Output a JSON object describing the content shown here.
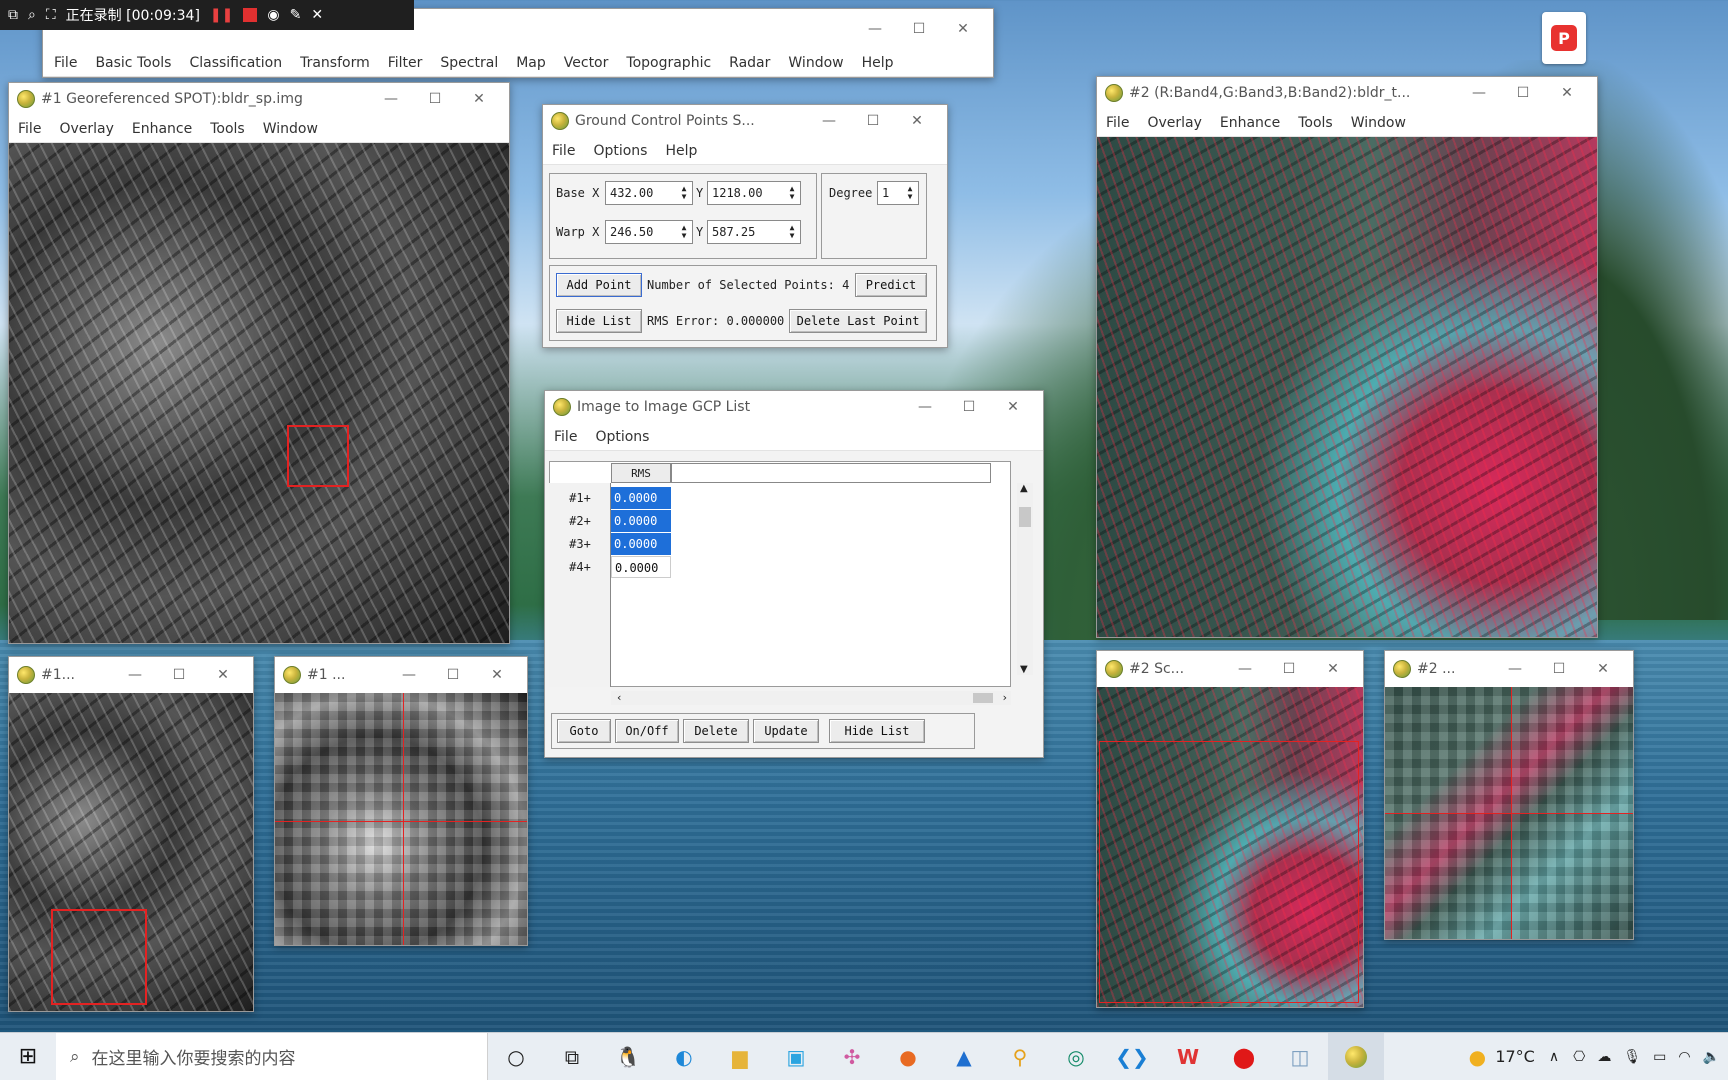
{
  "recorder": {
    "status": "正在录制 [00:09:34]"
  },
  "envi_main": {
    "menu": [
      "File",
      "Basic Tools",
      "Classification",
      "Transform",
      "Filter",
      "Spectral",
      "Map",
      "Vector",
      "Topographic",
      "Radar",
      "Window",
      "Help"
    ]
  },
  "display1": {
    "title": "#1 Georeferenced SPOT):bldr_sp.img",
    "menu": [
      "File",
      "Overlay",
      "Enhance",
      "Tools",
      "Window"
    ]
  },
  "display1_scroll": {
    "title": "#1..."
  },
  "display1_zoom": {
    "title": "#1 ..."
  },
  "display2": {
    "title": "#2 (R:Band4,G:Band3,B:Band2):bldr_t...",
    "menu": [
      "File",
      "Overlay",
      "Enhance",
      "Tools",
      "Window"
    ]
  },
  "display2_scroll": {
    "title": "#2 Sc..."
  },
  "display2_zoom": {
    "title": "#2 ..."
  },
  "gcp": {
    "title": "Ground Control Points S...",
    "menu": [
      "File",
      "Options",
      "Help"
    ],
    "base_label": "Base X",
    "warp_label": "Warp X",
    "y_label": "Y",
    "base_x": "432.00",
    "base_y": "1218.00",
    "warp_x": "246.50",
    "warp_y": "587.25",
    "degree_label": "Degree",
    "degree_value": "1",
    "add_point": "Add Point",
    "selected_points": "Number of Selected Points: 4",
    "predict": "Predict",
    "hide_list": "Hide List",
    "rms_error": "RMS Error: 0.000000",
    "delete_last": "Delete Last Point"
  },
  "gcp_list": {
    "title": "Image to Image GCP List",
    "menu": [
      "File",
      "Options"
    ],
    "column_header": "RMS",
    "rows": [
      {
        "label": "#1+",
        "rms": "0.0000",
        "selected": true
      },
      {
        "label": "#2+",
        "rms": "0.0000",
        "selected": true
      },
      {
        "label": "#3+",
        "rms": "0.0000",
        "selected": true
      },
      {
        "label": "#4+",
        "rms": "0.0000",
        "selected": false
      }
    ],
    "buttons": [
      "Goto",
      "On/Off",
      "Delete",
      "Update",
      "Hide List"
    ]
  },
  "taskbar": {
    "search_placeholder": "在这里输入你要搜索的内容",
    "temperature": "17°C"
  },
  "colors": {
    "selection": "#1e6fd9",
    "crosshair": "#e32222"
  }
}
